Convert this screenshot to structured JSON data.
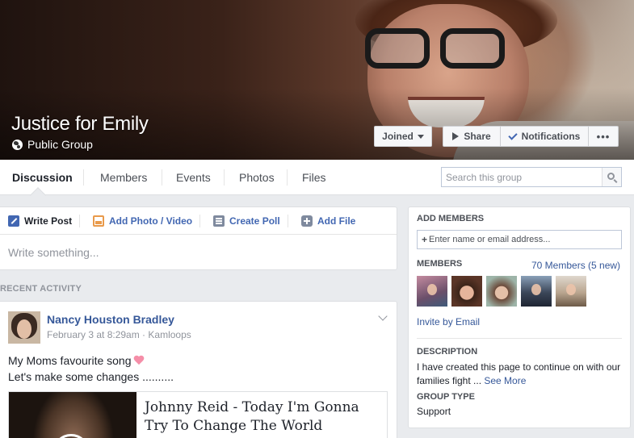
{
  "group": {
    "title": "Justice for Emily",
    "privacy": "Public Group"
  },
  "actions": {
    "joined": "Joined",
    "share": "Share",
    "notifications": "Notifications",
    "more": "•••"
  },
  "tabs": [
    {
      "label": "Discussion",
      "active": true
    },
    {
      "label": "Members"
    },
    {
      "label": "Events"
    },
    {
      "label": "Photos"
    },
    {
      "label": "Files"
    }
  ],
  "search": {
    "placeholder": "Search this group"
  },
  "composer": {
    "tabs": [
      "Write Post",
      "Add Photo / Video",
      "Create Poll",
      "Add File"
    ],
    "placeholder": "Write something..."
  },
  "recent_activity_label": "RECENT ACTIVITY",
  "post": {
    "author": "Nancy Houston Bradley",
    "meta": "February 3 at 8:29am · Kamloops",
    "line1": "My Moms favourite song",
    "line2": "Let's make some changes ..........",
    "link_title": "Johnny Reid - Today I'm Gonna Try To Change The World"
  },
  "sidebar": {
    "add_members_heading": "ADD MEMBERS",
    "add_members_placeholder": "Enter name or email address...",
    "add_members_plus": "+",
    "members_heading": "MEMBERS",
    "members_count": "70 Members (5 new)",
    "invite": "Invite by Email",
    "description_heading": "DESCRIPTION",
    "description": "I have created this page to continue on with our families fight ...",
    "see_more": "See More",
    "group_type_heading": "GROUP TYPE",
    "group_type": "Support"
  },
  "colors": {
    "link": "#365899",
    "accent": "#4267b2",
    "background": "#e9ebee"
  }
}
